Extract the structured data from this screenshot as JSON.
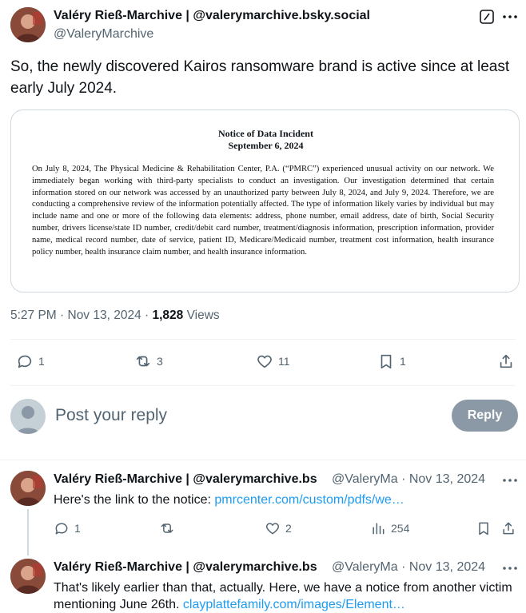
{
  "main_tweet": {
    "author_name": "Valéry Rieß-Marchive | @valerymarchive.bsky.social",
    "author_handle": "@ValeryMarchive",
    "text": "So, the newly discovered Kairos ransomware brand is active since at least early July 2024.",
    "image_doc": {
      "title_line1": "Notice of Data Incident",
      "title_line2": "September 6, 2024",
      "body": "On July 8, 2024, The Physical Medicine & Rehabilitation Center, P.A. (“PMRC”) experienced unusual activity on our network. We immediately began working with third-party specialists to conduct an investigation. Our investigation determined that certain information stored on our network was accessed by an unauthorized party between July 8, 2024, and July 9, 2024. Therefore, we are conducting a comprehensive review of the information potentially affected. The type of information likely varies by individual but may include name and one or more of the following data elements: address, phone number, email address, date of birth, Social Security number, drivers license/state ID number, credit/debit card number, treatment/diagnosis information, prescription information, provider name, medical record number, date of service, patient ID, Medicare/Medicaid number, treatment cost information, health insurance policy number, health insurance claim number, and health insurance information."
    },
    "time": "5:27 PM · Nov 13, 2024 · ",
    "views_count": "1,828",
    "views_label": " Views",
    "replies": "1",
    "reposts": "3",
    "likes": "11",
    "bookmarks": "1"
  },
  "reply_box": {
    "placeholder": "Post your reply",
    "button_label": "Reply"
  },
  "replies": [
    {
      "author_name": "Valéry Rieß-Marchive | @valerymarchive.bs",
      "handle_date": "@ValeryMa · Nov 13, 2024",
      "text_prefix": "Here's the link to the notice: ",
      "link": "pmrcenter.com/custom/pdfs/we…",
      "replies": "1",
      "reposts": "",
      "likes": "2",
      "views": "254"
    },
    {
      "author_name": "Valéry Rieß-Marchive | @valerymarchive.bs",
      "handle_date": "@ValeryMa · Nov 13, 2024",
      "text_prefix": "That's likely earlier than that, actually. Here, we have a notice from another victim mentioning June 26th. ",
      "link": "clayplattefamily.com/images/Element…"
    }
  ]
}
